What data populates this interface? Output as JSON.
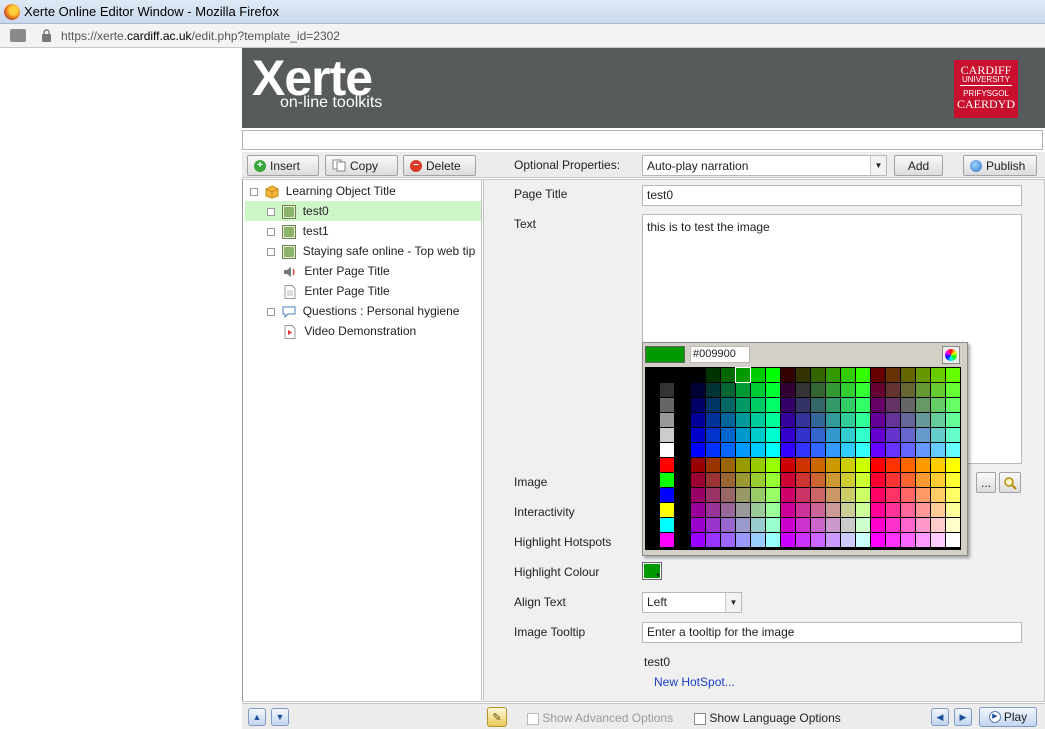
{
  "window": {
    "title": "Xerte Online Editor Window - Mozilla Firefox"
  },
  "address": {
    "prefix": "https://xerte.",
    "domain": "cardiff.ac.uk",
    "path": "/edit.php?template_id=2302"
  },
  "banner": {
    "logo_main": "Xerte",
    "logo_sub": "on-line toolkits",
    "uni_line1": "CARDIFF",
    "uni_line2": "UNIVERSITY",
    "uni_line3": "PRIFYSGOL",
    "uni_line4": "CAERDYD"
  },
  "toolbar": {
    "insert": "Insert",
    "copy": "Copy",
    "delete": "Delete",
    "optional_label": "Optional Properties:",
    "optional_value": "Auto-play narration",
    "add": "Add",
    "publish": "Publish"
  },
  "tree": {
    "items": [
      {
        "label": "Learning Object Title",
        "icon": "package-icon"
      },
      {
        "label": "test0",
        "icon": "image-page-icon"
      },
      {
        "label": "test1",
        "icon": "image-page-icon"
      },
      {
        "label": "Staying safe online - Top web tip",
        "icon": "image-page-icon"
      },
      {
        "label": "Enter Page Title",
        "icon": "audio-icon"
      },
      {
        "label": "Enter Page Title",
        "icon": "document-icon"
      },
      {
        "label": "Questions : Personal hygiene",
        "icon": "speech-bubble-icon"
      },
      {
        "label": "Video Demonstration",
        "icon": "video-icon"
      }
    ]
  },
  "properties": {
    "page_title_label": "Page Title",
    "page_title_value": "test0",
    "text_label": "Text",
    "text_value": "this is to test the image",
    "image_label": "Image",
    "browse_btn": "...",
    "interactivity_label": "Interactivity",
    "highlight_hotspots_label": "Highlight Hotspots",
    "highlight_colour_label": "Highlight Colour",
    "align_text_label": "Align Text",
    "align_text_value": "Left",
    "image_tooltip_label": "Image Tooltip",
    "image_tooltip_value": "Enter a tooltip for the image",
    "hotspot_name": "test0",
    "new_hotspot": "New HotSpot..."
  },
  "color_picker": {
    "selected_hex": "#009900",
    "selected_color": "#009900"
  },
  "bottom": {
    "show_advanced": "Show Advanced Options",
    "show_language": "Show Language Options",
    "play": "Play"
  }
}
